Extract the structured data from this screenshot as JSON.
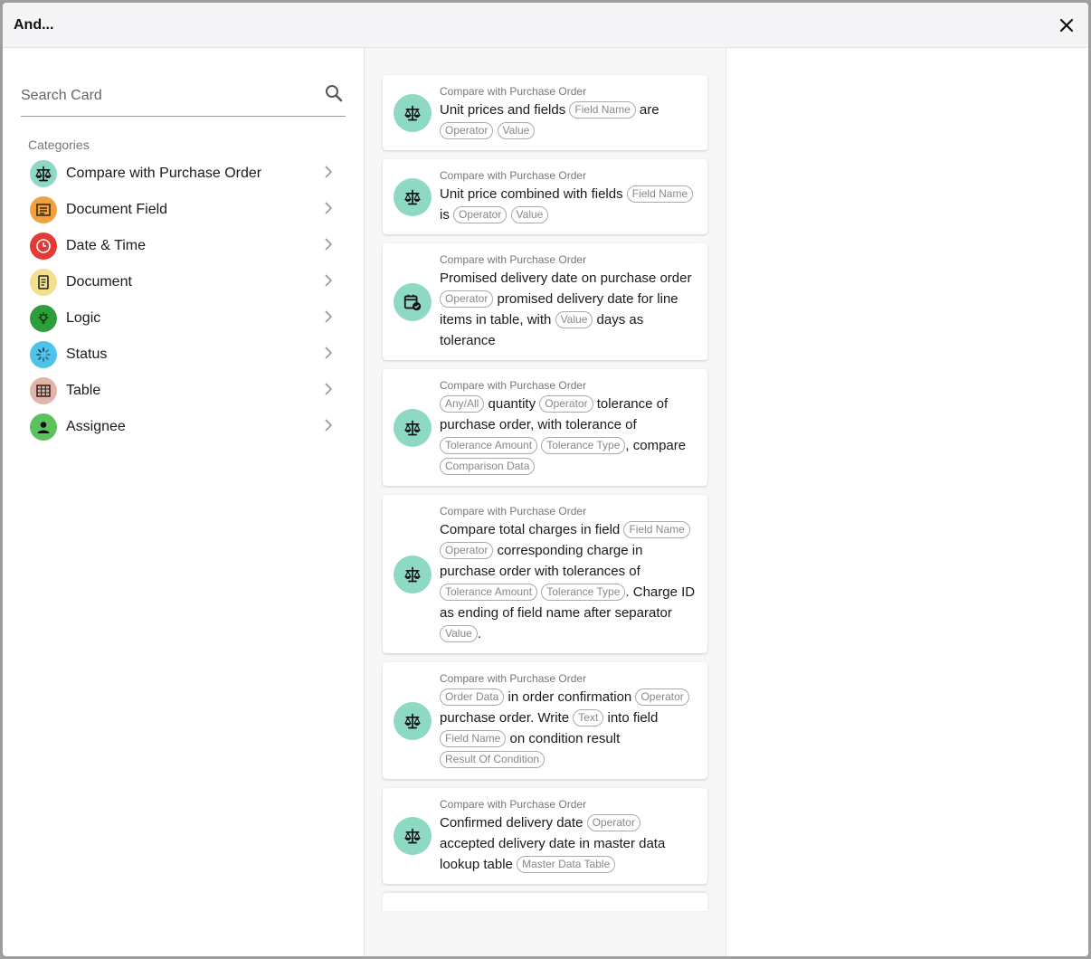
{
  "dialog": {
    "title": "And..."
  },
  "search": {
    "placeholder": "Search Card"
  },
  "categories": {
    "label": "Categories",
    "items": [
      {
        "label": "Compare with Purchase Order",
        "icon": "scale-icon",
        "color": "#8ed9c4"
      },
      {
        "label": "Document Field",
        "icon": "form-icon",
        "color": "#f0a040"
      },
      {
        "label": "Date & Time",
        "icon": "clock-icon",
        "color": "#e53935"
      },
      {
        "label": "Document",
        "icon": "document-icon",
        "color": "#f3e08f"
      },
      {
        "label": "Logic",
        "icon": "bulb-icon",
        "color": "#2e9e3a"
      },
      {
        "label": "Status",
        "icon": "spinner-icon",
        "color": "#4fc3e8"
      },
      {
        "label": "Table",
        "icon": "table-icon",
        "color": "#e3b3a8"
      },
      {
        "label": "Assignee",
        "icon": "person-icon",
        "color": "#5cc25c"
      }
    ]
  },
  "cards": [
    {
      "category": "Compare with Purchase Order",
      "icon": "scale-icon",
      "parts": [
        [
          "t",
          "Unit prices and fields "
        ],
        [
          "c",
          "Field Name"
        ],
        [
          "t",
          " are "
        ],
        [
          "c",
          "Operator"
        ],
        [
          "t",
          " "
        ],
        [
          "c",
          "Value"
        ]
      ]
    },
    {
      "category": "Compare with Purchase Order",
      "icon": "scale-icon",
      "parts": [
        [
          "t",
          "Unit price combined with fields "
        ],
        [
          "c",
          "Field Name"
        ],
        [
          "t",
          " is "
        ],
        [
          "c",
          "Operator"
        ],
        [
          "t",
          " "
        ],
        [
          "c",
          "Value"
        ]
      ]
    },
    {
      "category": "Compare with Purchase Order",
      "icon": "calendar-check-icon",
      "parts": [
        [
          "t",
          "Promised delivery date on purchase order "
        ],
        [
          "c",
          "Operator"
        ],
        [
          "t",
          " promised delivery date for line items in table, with "
        ],
        [
          "c",
          "Value"
        ],
        [
          "t",
          " days as tolerance"
        ]
      ]
    },
    {
      "category": "Compare with Purchase Order",
      "icon": "scale-icon",
      "parts": [
        [
          "c",
          "Any/All"
        ],
        [
          "t",
          " quantity "
        ],
        [
          "c",
          "Operator"
        ],
        [
          "t",
          " tolerance of purchase order, with tolerance of "
        ],
        [
          "c",
          "Tolerance Amount"
        ],
        [
          "t",
          " "
        ],
        [
          "c",
          "Tolerance Type"
        ],
        [
          "t",
          ", compare "
        ],
        [
          "c",
          "Comparison Data"
        ]
      ]
    },
    {
      "category": "Compare with Purchase Order",
      "icon": "scale-icon",
      "parts": [
        [
          "t",
          "Compare total charges in field "
        ],
        [
          "c",
          "Field Name"
        ],
        [
          "t",
          " "
        ],
        [
          "c",
          "Operator"
        ],
        [
          "t",
          " corresponding charge in purchase order with tolerances of "
        ],
        [
          "c",
          "Tolerance Amount"
        ],
        [
          "t",
          " "
        ],
        [
          "c",
          "Tolerance Type"
        ],
        [
          "t",
          ". Charge ID as ending of field name after separator "
        ],
        [
          "c",
          "Value"
        ],
        [
          "t",
          "."
        ]
      ]
    },
    {
      "category": "Compare with Purchase Order",
      "icon": "scale-icon",
      "parts": [
        [
          "c",
          "Order Data"
        ],
        [
          "t",
          " in order confirmation "
        ],
        [
          "c",
          "Operator"
        ],
        [
          "t",
          " purchase order. Write "
        ],
        [
          "c",
          "Text"
        ],
        [
          "t",
          " into field "
        ],
        [
          "c",
          "Field Name"
        ],
        [
          "t",
          " on condition result "
        ],
        [
          "c",
          "Result Of Condition"
        ]
      ]
    },
    {
      "category": "Compare with Purchase Order",
      "icon": "scale-icon",
      "parts": [
        [
          "t",
          "Confirmed delivery date "
        ],
        [
          "c",
          "Operator"
        ],
        [
          "t",
          " accepted delivery date in master data lookup table "
        ],
        [
          "c",
          "Master Data Table"
        ]
      ]
    }
  ]
}
